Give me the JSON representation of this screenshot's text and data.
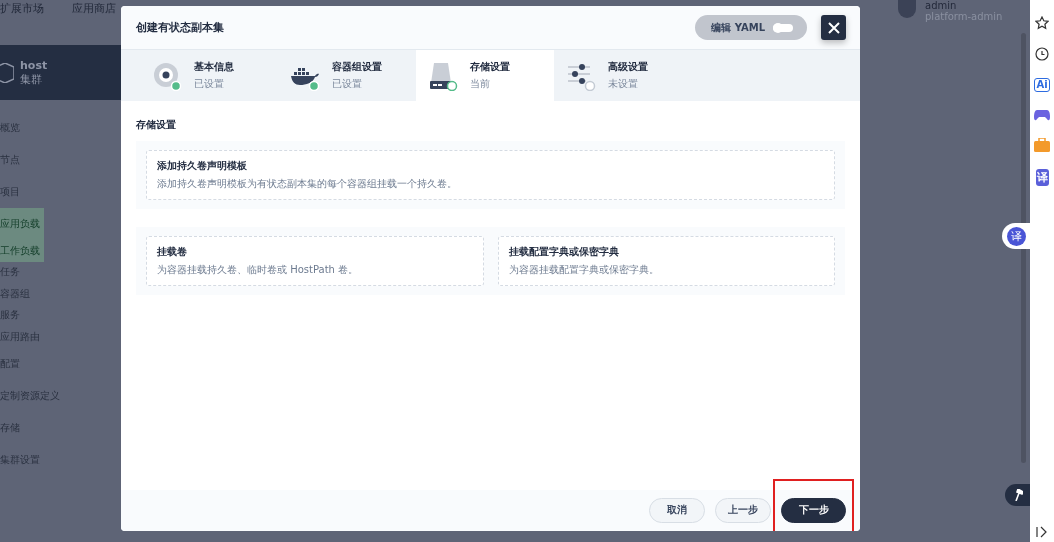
{
  "top_bar": {
    "items": [
      "扩展市场",
      "应用商店"
    ],
    "user": {
      "name": "admin",
      "role": "platform-admin"
    }
  },
  "cluster": {
    "name": "host",
    "kind": "集群"
  },
  "nav": [
    {
      "label": "概览",
      "selected": false
    },
    {
      "label": "节点",
      "selected": false
    },
    {
      "label": "项目",
      "selected": false
    },
    {
      "label": "应用负载",
      "selected": true,
      "children": [
        {
          "label": "工作负载",
          "selected": true
        },
        {
          "label": "任务",
          "selected": false
        },
        {
          "label": "容器组",
          "selected": false
        },
        {
          "label": "服务",
          "selected": false
        },
        {
          "label": "应用路由",
          "selected": false
        }
      ]
    },
    {
      "label": "配置",
      "selected": false
    },
    {
      "label": "定制资源定义",
      "selected": false
    },
    {
      "label": "存储",
      "selected": false
    },
    {
      "label": "集群设置",
      "selected": false
    }
  ],
  "dialog": {
    "title": "创建有状态副本集",
    "yaml_toggle": {
      "label": "编辑 YAML",
      "on": false
    },
    "steps": [
      {
        "kind": "disk",
        "title": "基本信息",
        "status": "已设置",
        "done": true,
        "selected": false
      },
      {
        "kind": "whale",
        "title": "容器组设置",
        "status": "已设置",
        "done": true,
        "selected": false
      },
      {
        "kind": "drive",
        "title": "存储设置",
        "status": "当前",
        "done": false,
        "selected": true
      },
      {
        "kind": "sliders",
        "title": "高级设置",
        "status": "未设置",
        "done": false,
        "selected": false
      }
    ],
    "section_title": "存储设置",
    "card_groups": [
      [
        {
          "title": "添加持久卷声明模板",
          "description": "添加持久卷声明模板为有状态副本集的每个容器组挂载一个持久卷。"
        }
      ],
      [
        {
          "title": "挂载卷",
          "description": "为容器挂载持久卷、临时卷或 HostPath 卷。"
        },
        {
          "title": "挂载配置字典或保密字典",
          "description": "为容器挂载配置字典或保密字典。"
        }
      ]
    ],
    "buttons": [
      {
        "label": "取消",
        "primary": false,
        "highlighted": false
      },
      {
        "label": "上一步",
        "primary": false,
        "highlighted": false
      },
      {
        "label": "下一步",
        "primary": true,
        "highlighted": true
      }
    ]
  },
  "browser_sidebar": {
    "ai_label": "Ai",
    "translate_label": "译",
    "floating_translate_label": "译"
  }
}
